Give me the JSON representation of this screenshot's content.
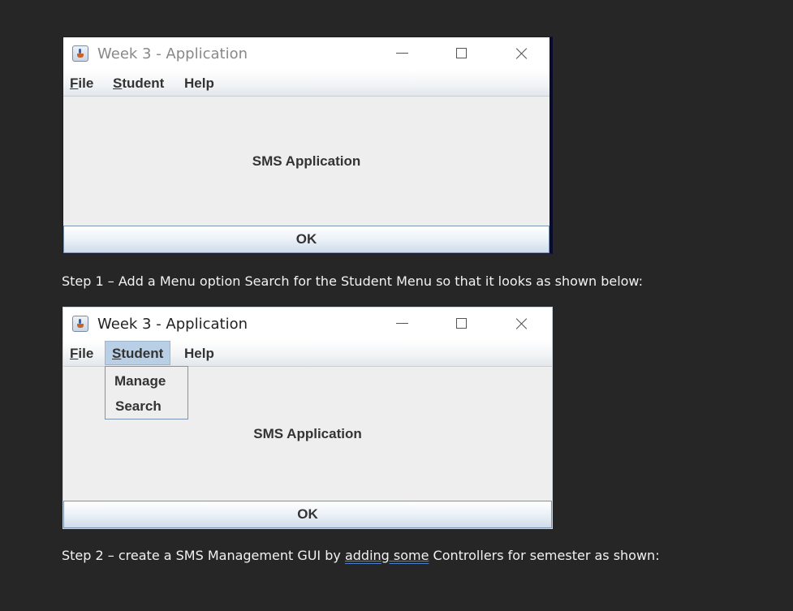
{
  "windows": [
    {
      "title": "Week 3 - Application",
      "menus": {
        "file": {
          "mnemonic": "F",
          "rest": "ile"
        },
        "student": {
          "mnemonic": "S",
          "rest": "tudent"
        },
        "help": "Help"
      },
      "content_label": "SMS Application",
      "ok_label": "OK"
    },
    {
      "title": "Week 3 - Application",
      "menus": {
        "file": {
          "mnemonic": "F",
          "rest": "ile"
        },
        "student": {
          "mnemonic": "S",
          "rest": "tudent"
        },
        "help": "Help"
      },
      "student_menu_open": true,
      "student_menu_items": [
        "Manage",
        "Search"
      ],
      "content_label": "SMS Application",
      "ok_label": "OK"
    }
  ],
  "document": {
    "step1": "Step 1 – Add a Menu option Search for the Student Menu so that it looks as shown below:",
    "step2": {
      "before": "Step 2 – create a SMS Management GUI by ",
      "underlined": "adding  some",
      "after": " Controllers for semester as shown:"
    }
  },
  "colors": {
    "page_background": "#262626",
    "window_background": "#eeeeee",
    "selected_menu": "#b8cfe5",
    "spellcheck_underline": "#4a7fd0"
  },
  "icons": [
    "java-app-icon",
    "minimize-icon",
    "maximize-icon",
    "close-icon"
  ]
}
